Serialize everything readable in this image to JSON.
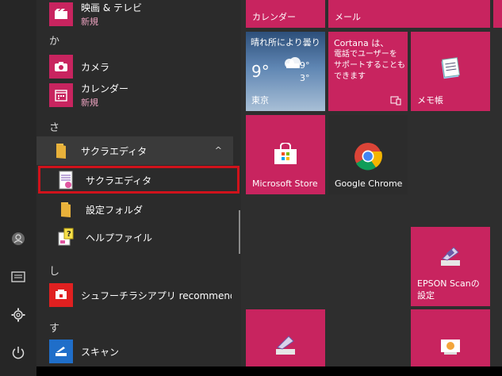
{
  "app_list": {
    "top_items": [
      {
        "label": "映画 & テレビ",
        "sub": "新規"
      }
    ],
    "sections": {
      "ka": "か",
      "sa": "さ",
      "shi": "し",
      "su": "す"
    },
    "camera_label": "カメラ",
    "calendar_label": "カレンダー",
    "calendar_sub": "新規",
    "folder_label": "サクラエディタ",
    "folder_chevron": "^",
    "sakura_label": "サクラエディタ",
    "settings_folder_label": "設定フォルダ",
    "help_label": "ヘルプファイル",
    "shred_label": "シュフーチラシアプリ recommended b...",
    "scan_label": "スキャン"
  },
  "tiles": {
    "calendar": "カレンダー",
    "mail": "メール",
    "weather_title": "晴れ所により曇り",
    "weather_temp": "9°",
    "weather_high": "9°",
    "weather_low": "3°",
    "weather_city": "東京",
    "cortana_title": "Cortana は、",
    "cortana_body": "電話でユーザーを サポートすることも できます",
    "memo": "メモ帳",
    "store": "Microsoft Store",
    "chrome": "Google Chrome",
    "epson": "EPSON Scanの 設定"
  },
  "colors": {
    "accent": "#c8245f",
    "highlight_box": "#d0121b"
  }
}
